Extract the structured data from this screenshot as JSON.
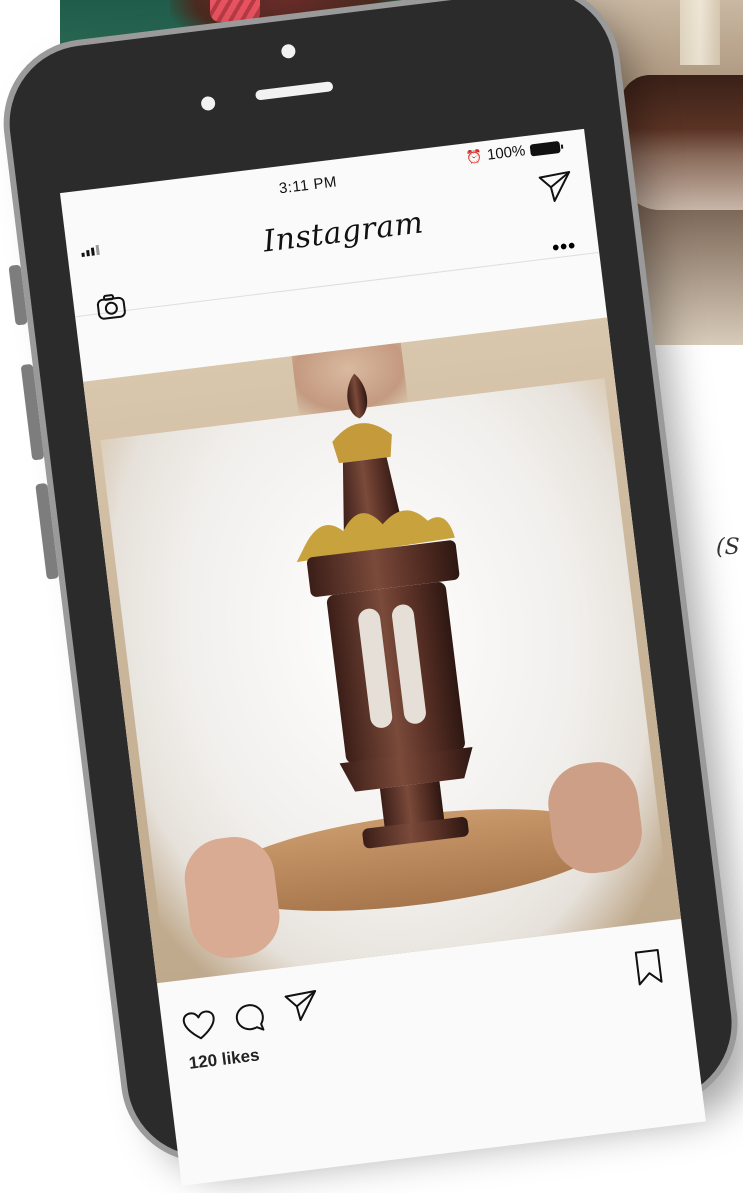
{
  "background_text": "(S",
  "status_bar": {
    "time": "3:11 PM",
    "battery": "100%"
  },
  "app": {
    "title": "Instagram"
  },
  "post": {
    "likes": "120 likes"
  },
  "icons": {
    "camera": "camera-icon",
    "direct": "paper-plane-icon",
    "more": "more-icon",
    "like": "heart-icon",
    "comment": "comment-icon",
    "share": "paper-plane-icon",
    "save": "bookmark-icon"
  },
  "colors": {
    "phone_body": "#2b2b2b",
    "phone_frame": "#9a9a9a",
    "screen_bg": "#fafafa",
    "text": "#111111"
  }
}
